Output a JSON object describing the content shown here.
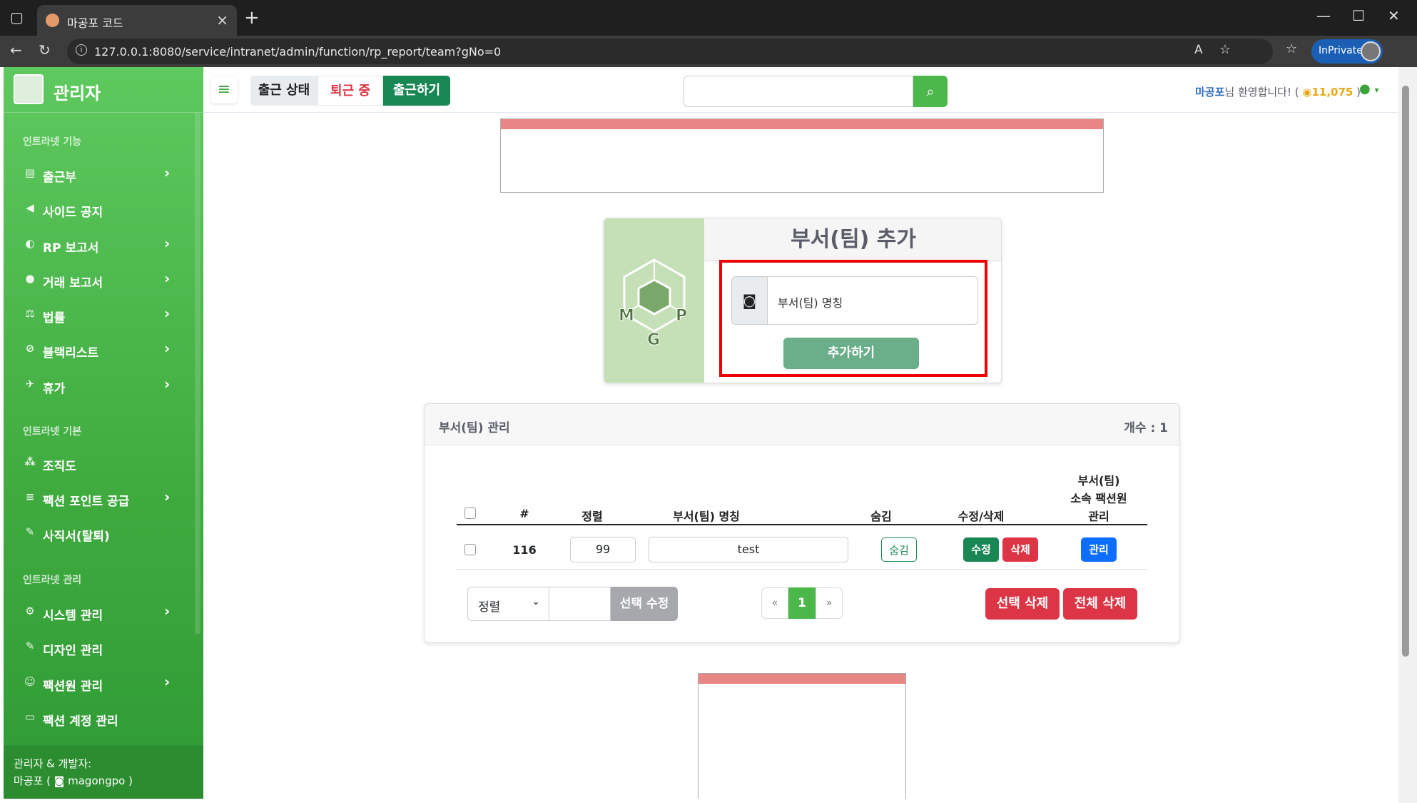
{
  "browser": {
    "tab_title": "마공포 코드",
    "url": "127.0.0.1:8080/service/intranet/admin/function/rp_report/team?gNo=0",
    "inprivate_label": "InPrivate"
  },
  "sidebar": {
    "brand": "관리자",
    "sections": [
      "인트라넷 기능",
      "인트라넷 기본",
      "인트라넷 관리"
    ],
    "items": [
      {
        "label": "출근부",
        "icon": "book-icon",
        "chevron": "›"
      },
      {
        "label": "사이드 공지",
        "icon": "megaphone-icon",
        "chevron": ""
      },
      {
        "label": "RP 보고서",
        "icon": "gamepad-icon",
        "chevron": "›"
      },
      {
        "label": "거래 보고서",
        "icon": "money-bag-icon",
        "chevron": "›"
      },
      {
        "label": "법률",
        "icon": "scale-icon",
        "chevron": "›"
      },
      {
        "label": "블랙리스트",
        "icon": "ban-icon",
        "chevron": "›"
      },
      {
        "label": "휴가",
        "icon": "plane-icon",
        "chevron": "›"
      },
      {
        "label": "조직도",
        "icon": "sitemap-icon",
        "chevron": ""
      },
      {
        "label": "팩션 포인트 공급",
        "icon": "coins-icon",
        "chevron": "›"
      },
      {
        "label": "사직서(탈퇴)",
        "icon": "pen-icon",
        "chevron": ""
      },
      {
        "label": "시스템 관리",
        "icon": "gear-icon",
        "chevron": "›"
      },
      {
        "label": "디자인 관리",
        "icon": "brush-icon",
        "chevron": ""
      },
      {
        "label": "팩션원 관리",
        "icon": "user-gear-icon",
        "chevron": "›"
      },
      {
        "label": "팩션 계정 관리",
        "icon": "id-card-icon",
        "chevron": ""
      }
    ],
    "footer_line1": "관리자 & 개발자:",
    "footer_line2": "마공포 ( ",
    "footer_discord": "magongpo",
    "footer_close": " )"
  },
  "topbar": {
    "attendance_status": "출근 상태",
    "off_work": "퇴근 중",
    "clock_in": "출근하기",
    "welcome_name": "마공포",
    "welcome_text": "님 환영합니다! (",
    "points": "11,075",
    "welcome_close": " )"
  },
  "add_team": {
    "title": "부서(팀) 추가",
    "placeholder": "부서(팀) 명칭",
    "submit": "추가하기"
  },
  "team_manage": {
    "title": "부서(팀) 관리",
    "count": "개수 : 1",
    "headers": {
      "num": "#",
      "sort": "정렬",
      "name": "부서(팀) 명칭",
      "hide": "숨김",
      "edit_delete": "수정/삭제",
      "members_l1": "부서(팀)",
      "members_l2": "소속 팩션원",
      "members_l3": "관리"
    },
    "rows": [
      {
        "id": "116",
        "sort": "99",
        "name": "test",
        "hide": "숨김",
        "edit": "수정",
        "delete": "삭제",
        "manage": "관리"
      }
    ],
    "sort_select": "정렬",
    "bulk_edit": "선택 수정",
    "pagination": {
      "prev": "«",
      "current": "1",
      "next": "»"
    },
    "delete_selected": "선택 삭제",
    "delete_all": "전체 삭제"
  },
  "colors": {
    "sidebar_green": "#4cb84c",
    "danger": "#dc3545",
    "success_dark": "#198754",
    "primary": "#0d6efd",
    "highlight_red": "#e00000"
  }
}
